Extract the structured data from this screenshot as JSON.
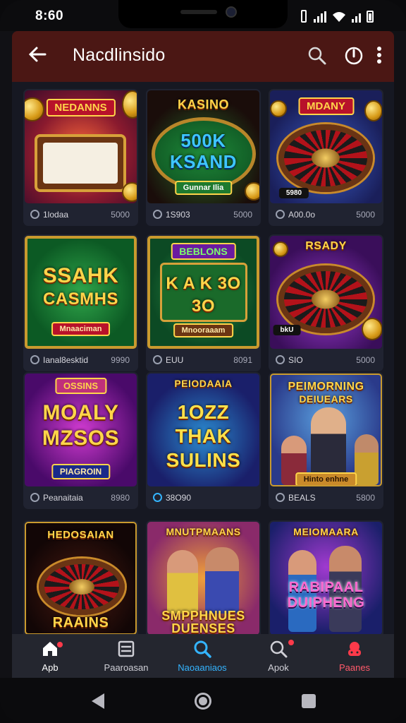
{
  "status": {
    "time": "8:60"
  },
  "appbar": {
    "title": "Nacdlinsido",
    "back_icon": "arrow-left-icon",
    "search_icon": "search-icon",
    "power_icon": "power-icon",
    "more_icon": "more-vertical-icon"
  },
  "games": [
    {
      "title": "NEDANNS",
      "sub": "",
      "badge": "",
      "name": "1lodaa",
      "value": "5000"
    },
    {
      "title": "KASINO",
      "sub": "500K KSAND",
      "badge": "Gunnar Ilia",
      "name": "1S903",
      "value": "5000"
    },
    {
      "title": "MDANY",
      "sub": "",
      "badge": "5980",
      "name": "A00.0o",
      "value": "5000"
    },
    {
      "title": "SSAHK",
      "sub": "CASMHS",
      "badge": "Mnaaciman",
      "name": "Ianal8esktid",
      "value": "9990"
    },
    {
      "title": "BEBLONS",
      "sub": "K A K 3O 3O",
      "badge": "Mnooraaam",
      "name": "EUU",
      "value": "8091"
    },
    {
      "title": "RSADY",
      "sub": "",
      "badge": "bkU",
      "name": "SIO",
      "value": "5000"
    },
    {
      "title": "OSSINS",
      "sub": "MOALY MZSOS",
      "badge": "PIAGROIN",
      "name": "Peanaitaia",
      "value": "8980"
    },
    {
      "title": "PEIODAAIA",
      "sub": "1OZZ THAK SULINS",
      "badge": "",
      "name": "38O90",
      "value": ""
    },
    {
      "title": "PEIMORNING",
      "sub": "DEIUEARS",
      "badge": "Hinto enhne",
      "name": "BEALS",
      "value": "5800"
    },
    {
      "title": "HEDOSAIAN",
      "sub": "RAAINS",
      "badge": "",
      "name": "",
      "value": ""
    },
    {
      "title": "MNUTPMAANS",
      "sub": "SMPPHNUES DUENSES",
      "badge": "",
      "name": "",
      "value": ""
    },
    {
      "title": "MEIOMAARA",
      "sub": "RABIPAAL DUIPHENG",
      "badge": "",
      "name": "",
      "value": ""
    }
  ],
  "bottom_nav": [
    {
      "label": "Apb",
      "icon": "home-icon"
    },
    {
      "label": "Paaroasan",
      "icon": "list-icon"
    },
    {
      "label": "Naoaaniaos",
      "icon": "search-icon"
    },
    {
      "label": "Apok",
      "icon": "search-icon"
    },
    {
      "label": "Paanes",
      "icon": "gamepad-icon"
    }
  ],
  "colors": {
    "appbar": "#4b1714",
    "active_nav": "#34b4ff",
    "alert": "#ff3a4a",
    "gold": "#ffd54a"
  }
}
